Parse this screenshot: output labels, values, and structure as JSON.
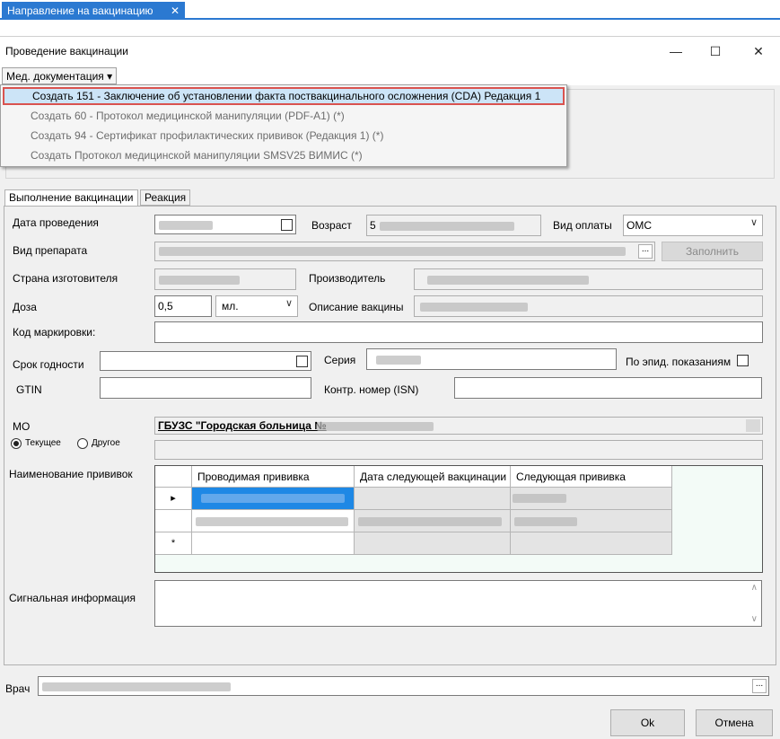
{
  "outer_tab": {
    "title": "Направление на вакцинацию",
    "close_glyph": "✕"
  },
  "window": {
    "title": "Проведение вакцинации",
    "minimize_glyph": "—",
    "maximize_glyph": "☐",
    "close_glyph": "✕"
  },
  "menu": {
    "med_docs_label": "Мед. документация",
    "caret": "▾"
  },
  "dropdown": {
    "items": [
      "Создать 151 - Заключение об установлении факта поствакцинального осложнения (CDA) Редакция 1",
      "Создать 60 - Протокол медицинской манипуляции (PDF-A1) (*)",
      "Создать 94 - Сертификат профилактических прививок (Редакция 1) (*)",
      "Создать Протокол медицинской манипуляции SMSV25 ВИМИС (*)"
    ]
  },
  "tabs": {
    "vaccination": "Выполнение вакцинации",
    "reaction": "Реакция"
  },
  "form": {
    "date_label": "Дата проведения",
    "age_label": "Возраст",
    "age_value_prefix": "5",
    "payment_label": "Вид оплаты",
    "payment_value": "ОМС",
    "drug_label": "Вид препарата",
    "fill_button": "Заполнить",
    "country_label": "Страна изготовителя",
    "manufacturer_label": "Производитель",
    "dose_label": "Доза",
    "dose_value": "0,5",
    "dose_unit": "мл.",
    "vaccine_desc_label": "Описание вакцины",
    "marking_code_label": "Код маркировки:",
    "expiry_label": "Срок годности",
    "series_label": "Серия",
    "epid_label": "По эпид. показаниям",
    "gtin_label": "GTIN",
    "isn_label": "Контр. номер (ISN)",
    "mo_label": "МО",
    "mo_value": "ГБУЗС \"Городская больница №",
    "radio_current": "Текущее",
    "radio_other": "Другое",
    "vaccinations_label": "Наименование прививок",
    "signal_label": "Сигнальная информация",
    "doctor_label": "Врач",
    "ellipsis": "..."
  },
  "grid": {
    "columns": [
      "Проводимая прививка",
      "Дата следующей вакцинации",
      "Следующая прививка"
    ],
    "row_markers": [
      "▸",
      "",
      "*"
    ]
  },
  "buttons": {
    "ok": "Ok",
    "cancel": "Отмена"
  },
  "icons": {
    "row_current": "triangle-right-icon",
    "new_row": "asterisk-icon",
    "combo": "chevron-down-icon",
    "scroll_up": "chevron-up-icon",
    "scroll_down": "chevron-down-icon"
  }
}
